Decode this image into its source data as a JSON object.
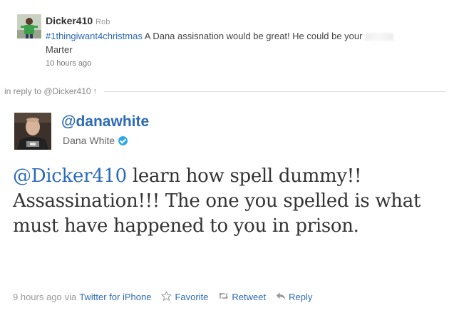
{
  "parent_tweet": {
    "username": "Dicker410",
    "display_name": "Rob",
    "hashtag": "#1thingiwant4christmas",
    "text": " A Dana assisnation would be great! He could be your ",
    "text_end": "Marter",
    "timestamp": "10 hours ago",
    "avatar_icon": "person-avatar-icon"
  },
  "in_reply": {
    "label": "in reply to @Dicker410",
    "arrow": "↑"
  },
  "tweet": {
    "handle": "@danawhite",
    "name": "Dana White",
    "mention": "@Dicker410",
    "text": " learn how spell dummy!! Assassination!!! The one you spelled is what must have happened to you in prison.",
    "timestamp": "9 hours ago",
    "via": "via",
    "source": "Twitter for iPhone",
    "verified_icon": "verified-badge-icon"
  },
  "actions": {
    "favorite": "Favorite",
    "retweet": "Retweet",
    "reply": "Reply"
  },
  "colors": {
    "link": "#2c6ab8",
    "text": "#333333",
    "muted": "#999999",
    "verified": "#2fa8e8"
  }
}
